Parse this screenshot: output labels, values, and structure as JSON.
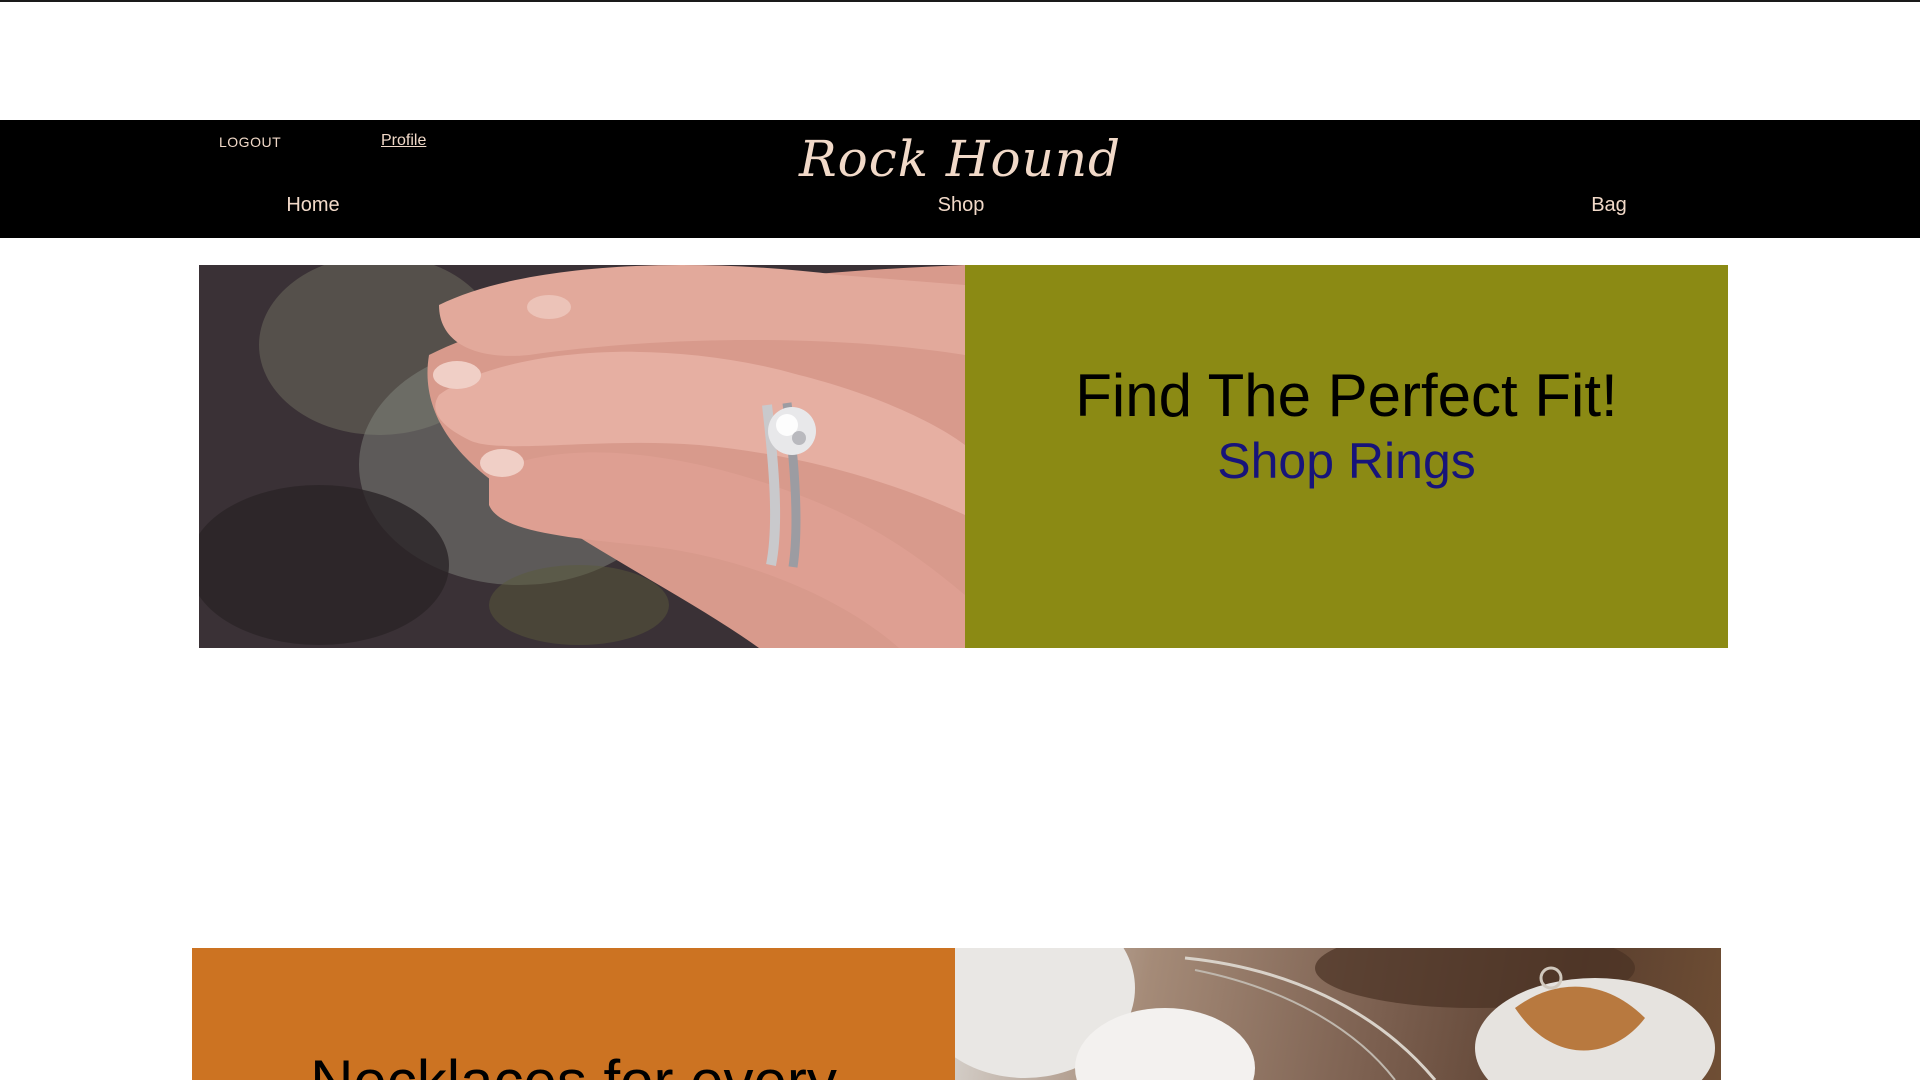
{
  "header": {
    "logout_label": "LOGOUT",
    "profile_label": "Profile",
    "brand": "Rock Hound",
    "nav": {
      "home": "Home",
      "shop": "Shop",
      "bag": "Bag"
    }
  },
  "rings_promo": {
    "headline": "Find The Perfect Fit!",
    "link_label": "Shop Rings"
  },
  "necklaces_promo": {
    "headline": "Necklaces for every"
  },
  "colors": {
    "header_bg": "#000000",
    "header_text": "#f1d9c8",
    "rings_panel": "#8b8a14",
    "rings_link": "#17147a",
    "necklaces_panel": "#cc7322"
  }
}
